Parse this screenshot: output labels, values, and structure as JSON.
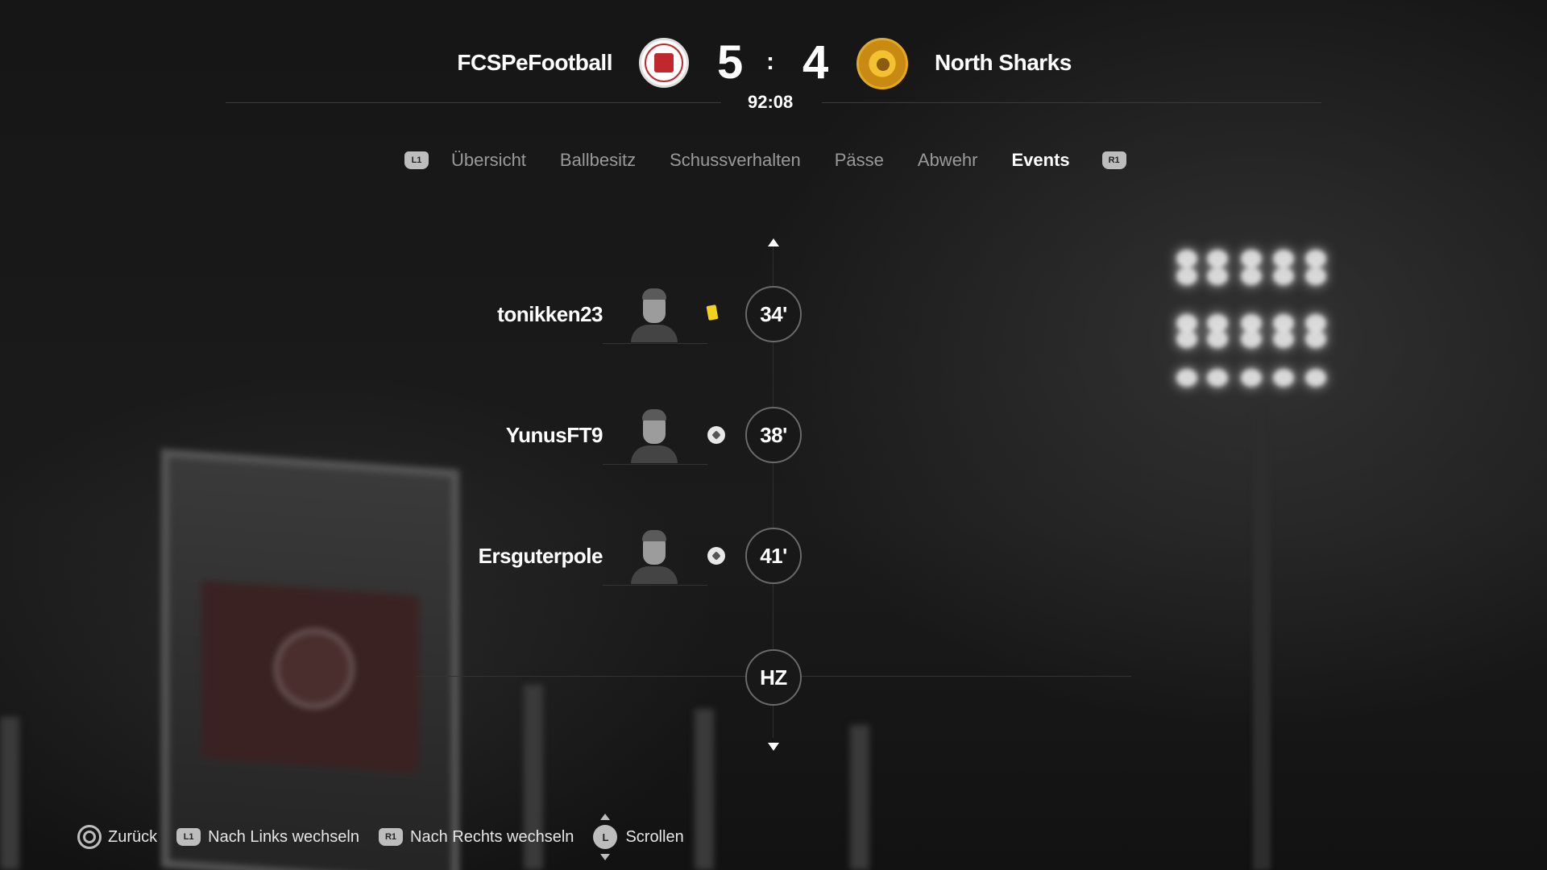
{
  "match": {
    "home_team": "FCSPeFootball",
    "away_team": "North Sharks",
    "home_score": "5",
    "separator": ":",
    "away_score": "4",
    "clock": "92:08"
  },
  "tabs": {
    "prev_button": "L1",
    "next_button": "R1",
    "items": [
      {
        "label": "Übersicht"
      },
      {
        "label": "Ballbesitz"
      },
      {
        "label": "Schussverhalten"
      },
      {
        "label": "Pässe"
      },
      {
        "label": "Abwehr"
      },
      {
        "label": "Events"
      }
    ],
    "active": "Events"
  },
  "events": [
    {
      "player": "tonikken23",
      "type": "yellow-card",
      "minute": "34'"
    },
    {
      "player": "YunusFT9",
      "type": "goal",
      "minute": "38'"
    },
    {
      "player": "Ersguterpole",
      "type": "goal",
      "minute": "41'"
    }
  ],
  "halftime_marker": "HZ",
  "footer": {
    "back_label": "Zurück",
    "l1_badge": "L1",
    "left_label": "Nach Links wechseln",
    "r1_badge": "R1",
    "right_label": "Nach Rechts wechseln",
    "stick_badge": "L",
    "scroll_label": "Scrollen"
  },
  "colors": {
    "background": "#141414",
    "yellow_card": "#f2d21c",
    "home_crest_red": "#c0282e",
    "away_crest_gold": "#e0a926"
  }
}
